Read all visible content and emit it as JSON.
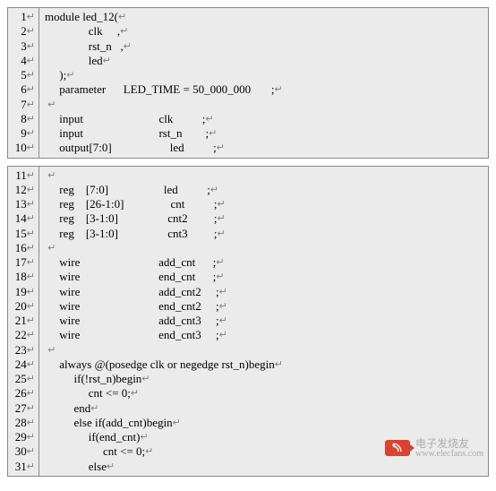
{
  "newline_glyph": "↵",
  "blocks": [
    {
      "start": 1,
      "lines": [
        "module led_12(",
        "               clk     ,",
        "               rst_n   ,",
        "               led",
        "     );",
        "     parameter      LED_TIME = 50_000_000       ;",
        "",
        "     input                          clk          ;",
        "     input                          rst_n        ;",
        "     output[7:0]                    led          ;"
      ]
    },
    {
      "start": 11,
      "lines": [
        "",
        "     reg    [7:0]                   led          ;",
        "     reg    [26-1:0]                cnt          ;",
        "     reg    [3-1:0]                 cnt2         ;",
        "     reg    [3-1:0]                 cnt3         ;",
        "",
        "     wire                           add_cnt      ;",
        "     wire                           end_cnt      ;",
        "     wire                           add_cnt2     ;",
        "     wire                           end_cnt2     ;",
        "     wire                           add_cnt3     ;",
        "     wire                           end_cnt3     ;",
        "",
        "     always @(posedge clk or negedge rst_n)begin",
        "          if(!rst_n)begin",
        "               cnt <= 0;",
        "          end",
        "          else if(add_cnt)begin",
        "               if(end_cnt)",
        "                    cnt <= 0;",
        "               else"
      ]
    }
  ],
  "watermark": {
    "icon_name": "ee-icon",
    "name_zh": "电子发烧友",
    "url": "www.elecfans.com"
  }
}
